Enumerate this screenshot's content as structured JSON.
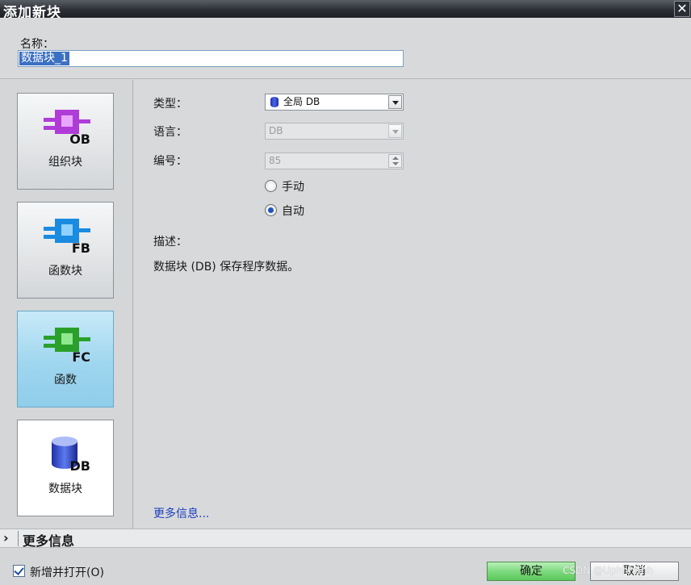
{
  "window": {
    "title": "添加新块",
    "close_glyph": "✕"
  },
  "name": {
    "label": "名称：",
    "value": "数据块_1"
  },
  "block_types": [
    {
      "label": "组织块",
      "badge": "OB",
      "color": "#b03cd8"
    },
    {
      "label": "函数块",
      "badge": "FB",
      "color": "#1a8be0"
    },
    {
      "label": "函数",
      "badge": "FC",
      "color": "#2aa02a",
      "selected": true
    },
    {
      "label": "数据块",
      "badge": "DB",
      "color": "#2a3fd0"
    }
  ],
  "form": {
    "type_label": "类型：",
    "type_value": "全局 DB",
    "language_label": "语言：",
    "language_value": "DB",
    "number_label": "编号：",
    "number_value": "85",
    "manual_label": "手动",
    "auto_label": "自动",
    "description_label": "描述：",
    "description_text": "数据块 (DB) 保存程序数据。",
    "more_info_link": "更多信息..."
  },
  "more_info_bar": {
    "chevron": "›",
    "label": "更多信息"
  },
  "footer": {
    "checkbox_label": "新增并打开(O)",
    "ok_label": "确定",
    "cancel_label": "取消",
    "watermark": "CSDN @Uphhhhhh"
  }
}
